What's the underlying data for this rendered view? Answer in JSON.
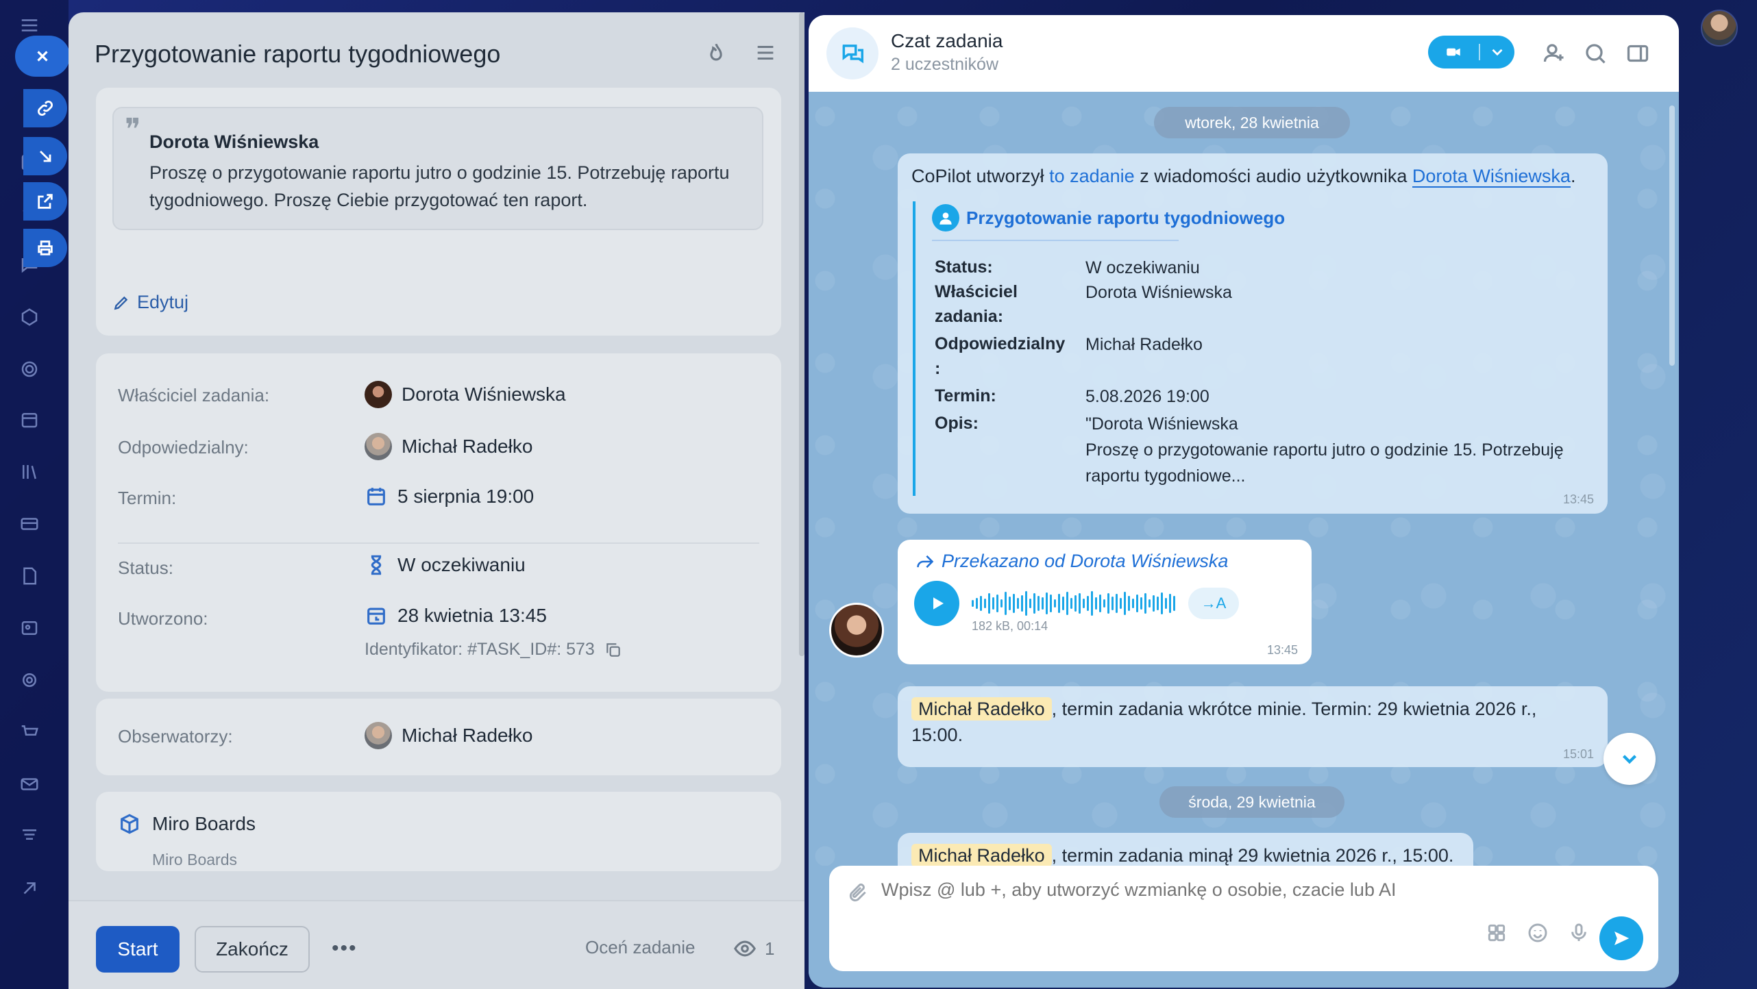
{
  "task": {
    "title": "Przygotowanie raportu tygodniowego",
    "quote_author": "Dorota Wiśniewska",
    "quote_text": "Proszę o przygotowanie raportu jutro o godzinie 15. Potrzebuję raportu tygodniowego. Proszę Ciebie przygotować ten raport.",
    "edit_label": "Edytuj",
    "fields": {
      "owner_label": "Właściciel zadania:",
      "owner_value": "Dorota Wiśniewska",
      "responsible_label": "Odpowiedzialny:",
      "responsible_value": "Michał Radełko",
      "deadline_label": "Termin:",
      "deadline_value": "5 sierpnia 19:00",
      "status_label": "Status:",
      "status_value": "W oczekiwaniu",
      "created_label": "Utworzono:",
      "created_value": "28 kwietnia 13:45",
      "identifier": "Identyfikator: #TASK_ID#: 573"
    },
    "observers_label": "Obserwatorzy:",
    "observers_value": "Michał Radełko",
    "miro_title": "Miro Boards",
    "miro_sub": "Miro Boards",
    "footer": {
      "start": "Start",
      "finish": "Zakończ",
      "more": "•••",
      "rate": "Oceń zadanie",
      "views": "1"
    }
  },
  "chat": {
    "title": "Czat zadania",
    "subtitle": "2 uczestników",
    "date1": "wtorek, 28 kwietnia",
    "date2": "środa, 29 kwietnia",
    "msg1": {
      "prefix": "CoPilot utworzył ",
      "link1": "to zadanie",
      "middle": " z wiadomości audio użytkownika ",
      "link2": "Dorota Wiśniewska",
      "suffix": ".",
      "card_title": "Przygotowanie raportu tygodniowego",
      "status_label": "Status:",
      "status_value": "W oczekiwaniu",
      "owner_label": "Właściciel zadania:",
      "owner_value": "Dorota Wiśniewska",
      "resp_label": "Odpowiedzialny :",
      "resp_value": "Michał Radełko",
      "term_label": "Termin:",
      "term_value": "5.08.2026 19:00",
      "desc_label": "Opis:",
      "desc_line1": "\"Dorota Wiśniewska",
      "desc_line2": "Proszę o przygotowanie raportu jutro o godzinie 15. Potrzebuję raportu tygodniowe...",
      "time": "13:45"
    },
    "msg2": {
      "forwarded": "Przekazano od Dorota Wiśniewska",
      "transcribe": "→A",
      "meta": "182 kB, 00:14",
      "time": "13:45"
    },
    "msg3": {
      "mention": "Michał Radełko",
      "text": ", termin zadania wkrótce minie. Termin: 29 kwietnia 2026 r., 15:00.",
      "time": "15:01"
    },
    "msg4": {
      "mention": "Michał Radełko",
      "text": ", termin zadania minął 29 kwietnia 2026 r., 15:00."
    },
    "input_placeholder": "Wpisz @ lub +, aby utworzyć wzmiankę o osobie, czacie lub AI"
  }
}
